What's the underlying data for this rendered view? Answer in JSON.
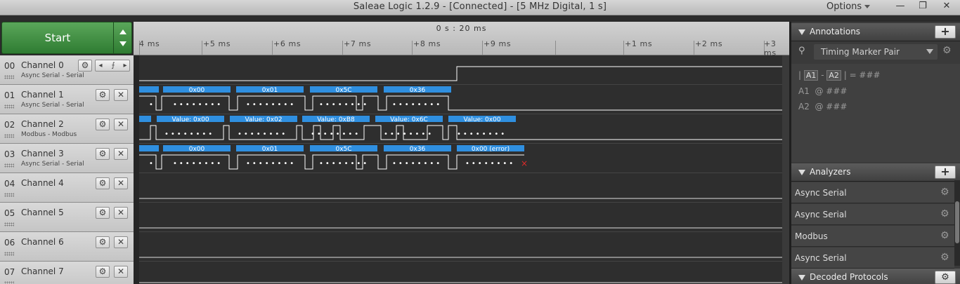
{
  "window": {
    "title": "Saleae Logic 1.2.9 - [Connected] - [5 MHz Digital, 1 s]",
    "options_label": "Options",
    "minimize": "—",
    "restore": "❐",
    "close": "✕"
  },
  "start": {
    "label": "Start"
  },
  "timeline": {
    "center_time": "0 s : 20 ms",
    "ticks": [
      "4 ms",
      "+5 ms",
      "+6 ms",
      "+7 ms",
      "+8 ms",
      "+9 ms",
      "+1 ms",
      "+2 ms",
      "+3 ms"
    ]
  },
  "channels": [
    {
      "num": "00",
      "name": "Channel 0",
      "sub": "Async Serial - Serial",
      "color": "#000000"
    },
    {
      "num": "01",
      "name": "Channel 1",
      "sub": "Async Serial - Serial",
      "color": "#8b4a1f"
    },
    {
      "num": "02",
      "name": "Channel 2",
      "sub": "Modbus - Modbus",
      "color": "#d42121"
    },
    {
      "num": "03",
      "name": "Channel 3",
      "sub": "Async Serial - Serial",
      "color": "#e07b1a"
    },
    {
      "num": "04",
      "name": "Channel 4",
      "sub": "",
      "color": "#d8c21b"
    },
    {
      "num": "05",
      "name": "Channel 5",
      "sub": "",
      "color": "#3ba83b"
    },
    {
      "num": "06",
      "name": "Channel 6",
      "sub": "",
      "color": "#2f4fcf"
    },
    {
      "num": "07",
      "name": "Channel 7",
      "sub": "",
      "color": "#9a3fc6"
    }
  ],
  "decoded": {
    "ch1": [
      "0x00",
      "0x01",
      "0x5C",
      "0x36"
    ],
    "ch2": [
      "Value: 0x00",
      "Value: 0x02",
      "Value: 0xB8",
      "Value: 0x6C",
      "Value: 0x00"
    ],
    "ch3": [
      "0x00",
      "0x01",
      "0x5C",
      "0x36",
      "0x00 (error)"
    ],
    "accent": "#2f8fe0",
    "error_mark": "×"
  },
  "annotations": {
    "title": "Annotations",
    "marker_pair": "Timing Marker Pair",
    "line1": {
      "a1": "A1",
      "a2": "A2",
      "value": "= ###"
    },
    "line2": {
      "label": "A1",
      "value": "@ ###"
    },
    "line3": {
      "label": "A2",
      "value": "@ ###"
    }
  },
  "analyzers": {
    "title": "Analyzers",
    "items": [
      "Async Serial",
      "Async Serial",
      "Modbus",
      "Async Serial"
    ]
  },
  "decoded_protocols": {
    "title": "Decoded Protocols"
  }
}
